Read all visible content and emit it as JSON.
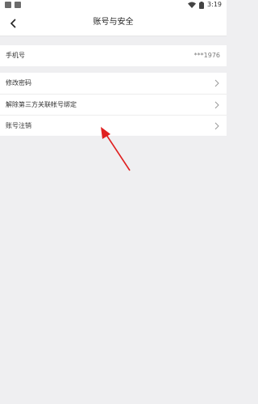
{
  "status_bar": {
    "time": "3:19"
  },
  "header": {
    "title": "账号与安全"
  },
  "phone_row": {
    "label": "手机号",
    "value": "***1976"
  },
  "menu": {
    "change_password": "修改密码",
    "unbind_third_party": "解除第三方关联帐号绑定",
    "delete_account": "账号注销"
  },
  "colors": {
    "annotation_arrow": "#e02020"
  }
}
